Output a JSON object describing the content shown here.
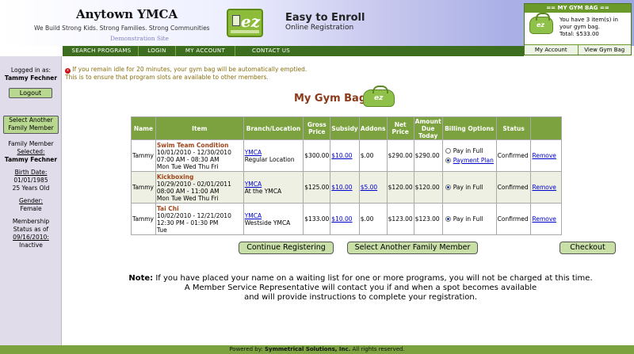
{
  "header": {
    "org_name": "Anytown YMCA",
    "tagline": "We Build Strong Kids. Strong Families. Strong Communities",
    "demo": "Demonstration Site",
    "logo_text": "ez",
    "app_title": "Easy to Enroll",
    "app_subtitle": "Online Registration"
  },
  "gym_bag_panel": {
    "title": "== MY GYM BAG ==",
    "icon_text": "ez",
    "message": "You have 3 item(s) in your gym bag.",
    "total": "Total: $533.00",
    "my_account": "My Account",
    "view_gym_bag": "View Gym Bag"
  },
  "nav": {
    "search": "SEARCH PROGRAMS",
    "login": "LOGIN",
    "account": "MY ACCOUNT",
    "contact": "CONTACT US"
  },
  "sidebar": {
    "logged_in_as": "Logged in as:",
    "user": "Tammy Fechner",
    "logout": "Logout",
    "select_family_line1": "Select Another",
    "select_family_line2": "Family Member",
    "family_member": "Family Member",
    "selected": "Selected:",
    "selected_name": "Tammy Fechner",
    "birth_date_label": "Birth Date:",
    "birth_date": "01/01/1985",
    "age": "25 Years Old",
    "gender_label": "Gender:",
    "gender": "Female",
    "membership": "Membership",
    "status_as_of": "Status as of",
    "status_date": "09/16/2010:",
    "status": "Inactive"
  },
  "warning": {
    "icon": "x",
    "line1": "If you remain idle for 20 minutes, your gym bag will be automatically emptied.",
    "line2": "This is to ensure that program slots are available to other members."
  },
  "page_title": "My Gym Bag",
  "title_icon_text": "ez",
  "table": {
    "headers": [
      "Name",
      "Item",
      "Branch/Location",
      "Gross Price",
      "Subsidy",
      "Addons",
      "Net Price",
      "Amount Due Today",
      "Billing Options",
      "Status",
      ""
    ],
    "rows": [
      {
        "name": "Tammy",
        "item_name": "Swim Team Condition",
        "dates": "10/01/2010 - 12/30/2010",
        "times": "07:00 AM - 08:30 AM",
        "days": "Mon Tue Wed Thu Fri",
        "branch": "YMCA",
        "location": "Regular Location",
        "gross": "$300.00",
        "subsidy": "$10.00",
        "addons": "$.00",
        "net": "$290.00",
        "due": "$290.00",
        "billing1": "Pay in Full",
        "billing2": "Payment Plan",
        "status": "Confirmed",
        "remove": "Remove"
      },
      {
        "name": "Tammy",
        "item_name": "Kickboxing",
        "dates": "10/29/2010 - 02/01/2011",
        "times": "08:00 AM - 11:00 AM",
        "days": "Mon Tue Wed Thu Fri",
        "branch": "YMCA",
        "location": "At the YMCA",
        "gross": "$125.00",
        "subsidy": "$10.00",
        "addons": "$5.00",
        "net": "$120.00",
        "due": "$120.00",
        "billing1": "Pay in Full",
        "status": "Confirmed",
        "remove": "Remove"
      },
      {
        "name": "Tammy",
        "item_name": "Tai Chi",
        "dates": "10/02/2010 - 12/21/2010",
        "times": "12:30 PM - 01:30 PM",
        "days": "Tue",
        "branch": "YMCA",
        "location": "Westside YMCA",
        "gross": "$133.00",
        "subsidy": "$10.00",
        "addons": "$.00",
        "net": "$123.00",
        "due": "$123.00",
        "billing1": "Pay in Full",
        "status": "Confirmed",
        "remove": "Remove"
      }
    ]
  },
  "buttons": {
    "continue": "Continue Registering",
    "select_family": "Select Another Family Member",
    "checkout": "Checkout"
  },
  "note": {
    "label": "Note:",
    "line1": " If you have placed your name on a waiting list for one or more programs, you will not be charged at this time.",
    "line2": "A Member Service Representative will contact you if and when a spot becomes available",
    "line3": "and will provide instructions to complete your registration."
  },
  "footer": {
    "prefix": "Powered by: ",
    "company": "Symmetrical Solutions, Inc.",
    "suffix": " All rights reserved."
  }
}
